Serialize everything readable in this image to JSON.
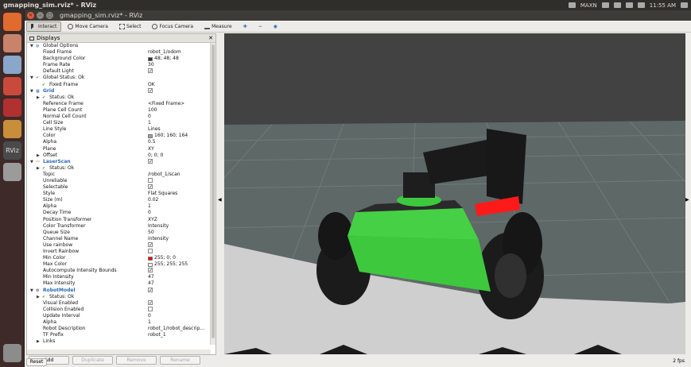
{
  "system_bar": {
    "title": "gmapping_sim.rviz* - RViz",
    "keyboard": "MAXN",
    "time": "11:55 AM"
  },
  "window": {
    "title": "gmapping_sim.rviz* - RViz"
  },
  "toolbar": {
    "tools": [
      "Interact",
      "Move Camera",
      "Select",
      "Focus Camera",
      "Measure"
    ]
  },
  "displays_panel": {
    "title": "Displays",
    "close": "✕",
    "rows": [
      {
        "d": 0,
        "exp": "▼",
        "icon": "globe-icon",
        "label": "Global Options",
        "value": ""
      },
      {
        "d": 1,
        "label": "Fixed Frame",
        "value": "robot_1/odom"
      },
      {
        "d": 1,
        "label": "Background Color",
        "value": "48; 48; 48",
        "swatch": "#303030"
      },
      {
        "d": 1,
        "label": "Frame Rate",
        "value": "30"
      },
      {
        "d": 1,
        "label": "Default Light",
        "value": "",
        "check": true
      },
      {
        "d": 0,
        "exp": "▼",
        "icon": "check-icon",
        "label": "Global Status: Ok",
        "value": ""
      },
      {
        "d": 1,
        "icon": "check-icon",
        "label": "Fixed Frame",
        "value": "OK"
      },
      {
        "d": 0,
        "exp": "▼",
        "icon": "grid-icon",
        "label": "Grid",
        "value": "",
        "check": true,
        "blue": true
      },
      {
        "d": 1,
        "exp": "▶",
        "icon": "check-icon",
        "label": "Status: Ok",
        "value": ""
      },
      {
        "d": 1,
        "label": "Reference Frame",
        "value": "<Fixed Frame>"
      },
      {
        "d": 1,
        "label": "Plane Cell Count",
        "value": "100"
      },
      {
        "d": 1,
        "label": "Normal Cell Count",
        "value": "0"
      },
      {
        "d": 1,
        "label": "Cell Size",
        "value": "1"
      },
      {
        "d": 1,
        "label": "Line Style",
        "value": "Lines"
      },
      {
        "d": 1,
        "label": "Color",
        "value": "160; 160; 164",
        "swatch": "#a0a0a4"
      },
      {
        "d": 1,
        "label": "Alpha",
        "value": "0.5"
      },
      {
        "d": 1,
        "label": "Plane",
        "value": "XY"
      },
      {
        "d": 1,
        "exp": "▶",
        "label": "Offset",
        "value": "0; 0; 0"
      },
      {
        "d": 0,
        "exp": "▼",
        "icon": "laser-icon",
        "label": "LaserScan",
        "value": "",
        "check": true,
        "blue": true
      },
      {
        "d": 1,
        "exp": "▶",
        "icon": "check-icon",
        "label": "Status: Ok",
        "value": ""
      },
      {
        "d": 1,
        "label": "Topic",
        "value": "/robot_1/scan"
      },
      {
        "d": 1,
        "label": "Unreliable",
        "value": "",
        "check": false
      },
      {
        "d": 1,
        "label": "Selectable",
        "value": "",
        "check": true
      },
      {
        "d": 1,
        "label": "Style",
        "value": "Flat Squares"
      },
      {
        "d": 1,
        "label": "Size (m)",
        "value": "0.02"
      },
      {
        "d": 1,
        "label": "Alpha",
        "value": "1"
      },
      {
        "d": 1,
        "label": "Decay Time",
        "value": "0"
      },
      {
        "d": 1,
        "label": "Position Transformer",
        "value": "XYZ"
      },
      {
        "d": 1,
        "label": "Color Transformer",
        "value": "Intensity"
      },
      {
        "d": 1,
        "label": "Queue Size",
        "value": "50"
      },
      {
        "d": 1,
        "label": "Channel Name",
        "value": "intensity"
      },
      {
        "d": 1,
        "label": "Use rainbow",
        "value": "",
        "check": true
      },
      {
        "d": 1,
        "label": "Invert Rainbow",
        "value": "",
        "check": false
      },
      {
        "d": 1,
        "label": "Min Color",
        "value": "255; 0; 0",
        "swatch": "#ff0000"
      },
      {
        "d": 1,
        "label": "Max Color",
        "value": "255; 255; 255",
        "swatch": "#ffffff"
      },
      {
        "d": 1,
        "label": "Autocompute Intensity Bounds",
        "value": "",
        "check": true
      },
      {
        "d": 1,
        "label": "Min Intensity",
        "value": "47"
      },
      {
        "d": 1,
        "label": "Max Intensity",
        "value": "47"
      },
      {
        "d": 0,
        "exp": "▼",
        "icon": "robot-icon",
        "label": "RobotModel",
        "value": "",
        "check": true,
        "blue": true
      },
      {
        "d": 1,
        "exp": "▶",
        "icon": "check-icon",
        "label": "Status: Ok",
        "value": ""
      },
      {
        "d": 1,
        "label": "Visual Enabled",
        "value": "",
        "check": true
      },
      {
        "d": 1,
        "label": "Collision Enabled",
        "value": "",
        "check": false
      },
      {
        "d": 1,
        "label": "Update Interval",
        "value": "0"
      },
      {
        "d": 1,
        "label": "Alpha",
        "value": "1"
      },
      {
        "d": 1,
        "label": "Robot Description",
        "value": "robot_1/robot_descrip..."
      },
      {
        "d": 1,
        "label": "TF Prefix",
        "value": "robot_1"
      },
      {
        "d": 1,
        "exp": "▶",
        "label": "Links",
        "value": ""
      }
    ],
    "buttons": [
      "Add",
      "Duplicate",
      "Remove",
      "Rename"
    ]
  },
  "statusbar": {
    "reset": "Reset",
    "fps": "2 fps"
  },
  "colors": {
    "grid_line": "#a0a0a4",
    "laser": "#ff1a1a",
    "chassis": "#3ec83e",
    "sky": "#424242"
  }
}
